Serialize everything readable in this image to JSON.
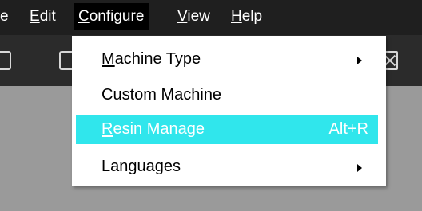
{
  "menubar": {
    "items": [
      {
        "label": "e",
        "accel": ""
      },
      {
        "accel": "E",
        "rest": "dit"
      },
      {
        "accel": "C",
        "rest": "onfigure"
      },
      {
        "accel": "V",
        "rest": "iew"
      },
      {
        "accel": "H",
        "rest": "elp"
      }
    ]
  },
  "configure_menu": {
    "items": [
      {
        "accel": "M",
        "rest": "achine Type",
        "submenu": true
      },
      {
        "label": "Custom Machine"
      },
      {
        "accel": "R",
        "rest": "esin Manage",
        "shortcut": "Alt+R",
        "highlighted": true
      },
      {
        "label": "Languages",
        "submenu": true
      }
    ]
  },
  "colors": {
    "menubar_bg": "#1f1f1f",
    "toolbar_bg": "#2b2b2b",
    "canvas_bg": "#9a9a9a",
    "highlight": "#30e6ec"
  },
  "icons": [
    "folder-icon",
    "save-icon",
    "close-icon",
    "submenu-arrow-icon"
  ]
}
